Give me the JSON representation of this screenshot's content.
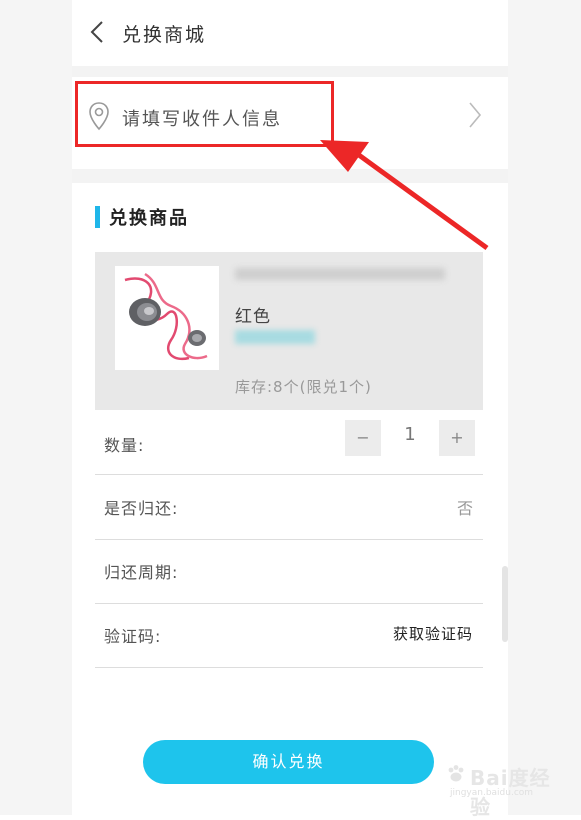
{
  "header": {
    "title": "兑换商城"
  },
  "address": {
    "placeholder_text": "请填写收件人信息"
  },
  "section": {
    "title": "兑换商品"
  },
  "product": {
    "color": "红色",
    "stock": "库存:8个(限兑1个)"
  },
  "form": {
    "quantity_label": "数量:",
    "quantity_minus": "−",
    "quantity_value": "1",
    "quantity_plus": "+",
    "return_label": "是否归还:",
    "return_value": "否",
    "period_label": "归还周期:",
    "code_label": "验证码:",
    "get_code_label": "获取验证码"
  },
  "confirm": {
    "label": "确认兑换"
  },
  "watermark": {
    "main": "Bai度经验",
    "sub": "jingyan.baidu.com"
  },
  "colors": {
    "accent": "#1ec4ec",
    "highlight": "#ec2727",
    "section_bar": "#1fb6e9"
  },
  "icons": {
    "back": "chevron-left-icon",
    "location": "location-pin-icon",
    "forward": "chevron-right-icon"
  }
}
